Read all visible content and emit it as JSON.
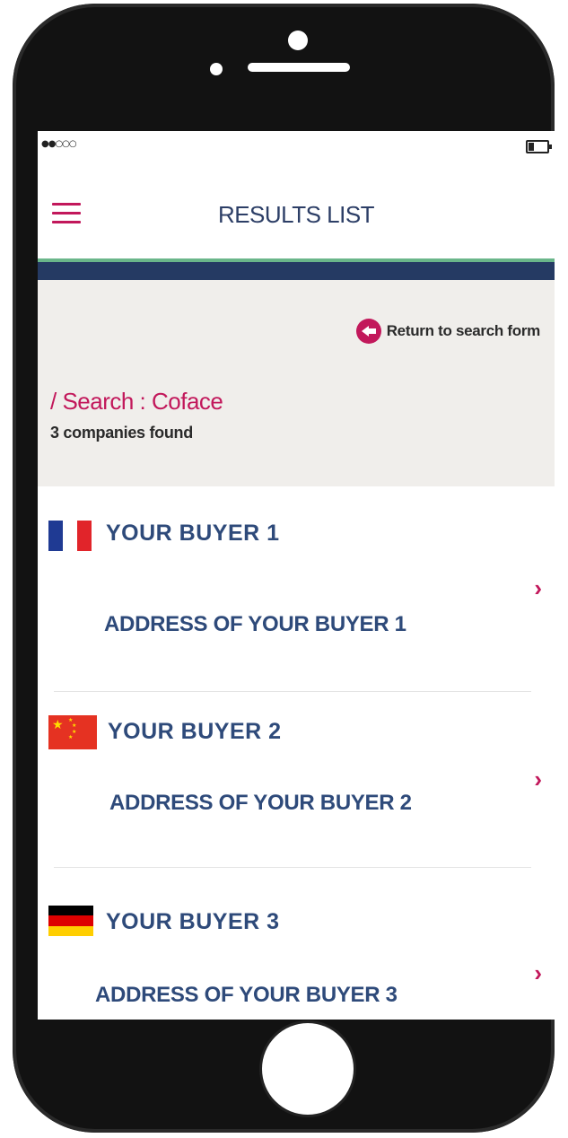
{
  "status_bar": {
    "signal": "●●○○○",
    "battery_level": 0.3
  },
  "header": {
    "title": "RESULTS LIST",
    "menu_icon": "hamburger-menu-icon"
  },
  "colors": {
    "accent": "#c2185b",
    "navy": "#253a63",
    "green": "#6ab68a",
    "panel_bg": "#f0eeeb",
    "text_blue": "#2e4a7a"
  },
  "search": {
    "return_label": "Return to search form",
    "return_icon": "arrow-left-circle-icon",
    "term": "/ Search : Coface",
    "count": "3 companies found"
  },
  "results": [
    {
      "name": "YOUR  BUYER 1",
      "address": "ADDRESS OF YOUR BUYER 1",
      "flag": "france-flag-icon",
      "chevron": "›"
    },
    {
      "name": "YOUR  BUYER 2",
      "address": "ADDRESS OF YOUR BUYER 2",
      "flag": "china-flag-icon",
      "chevron": "›"
    },
    {
      "name": "YOUR  BUYER 3",
      "address": "ADDRESS OF YOUR BUYER 3",
      "flag": "germany-flag-icon",
      "chevron": "›"
    }
  ]
}
